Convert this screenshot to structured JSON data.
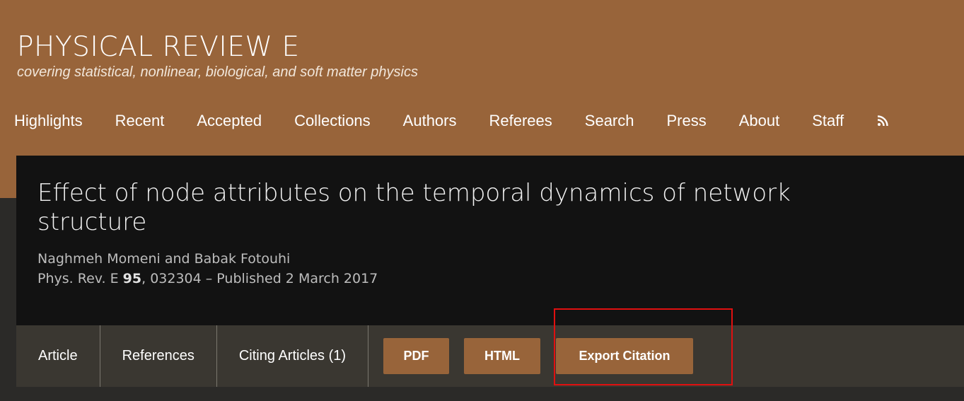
{
  "header": {
    "journal_title": "PHYSICAL REVIEW E",
    "journal_subtitle": "covering statistical, nonlinear, biological, and soft matter physics",
    "brand_color": "#98643a"
  },
  "nav": {
    "items": [
      {
        "label": "Highlights"
      },
      {
        "label": "Recent"
      },
      {
        "label": "Accepted"
      },
      {
        "label": "Collections"
      },
      {
        "label": "Authors"
      },
      {
        "label": "Referees"
      },
      {
        "label": "Search"
      },
      {
        "label": "Press"
      },
      {
        "label": "About"
      },
      {
        "label": "Staff"
      }
    ],
    "rss_icon": "rss-icon"
  },
  "article": {
    "title": "Effect of node attributes on the temporal dynamics of network structure",
    "authors": "Naghmeh Momeni and Babak Fotouhi",
    "citation_prefix": "Phys. Rev. E ",
    "volume": "95",
    "citation_suffix": ", 032304 – Published 2 March 2017"
  },
  "tabs": [
    {
      "label": "Article"
    },
    {
      "label": "References"
    },
    {
      "label": "Citing Articles (1)"
    }
  ],
  "buttons": {
    "pdf": "PDF",
    "html": "HTML",
    "export_citation": "Export Citation"
  },
  "annotation": {
    "highlight_color": "#e01010"
  }
}
